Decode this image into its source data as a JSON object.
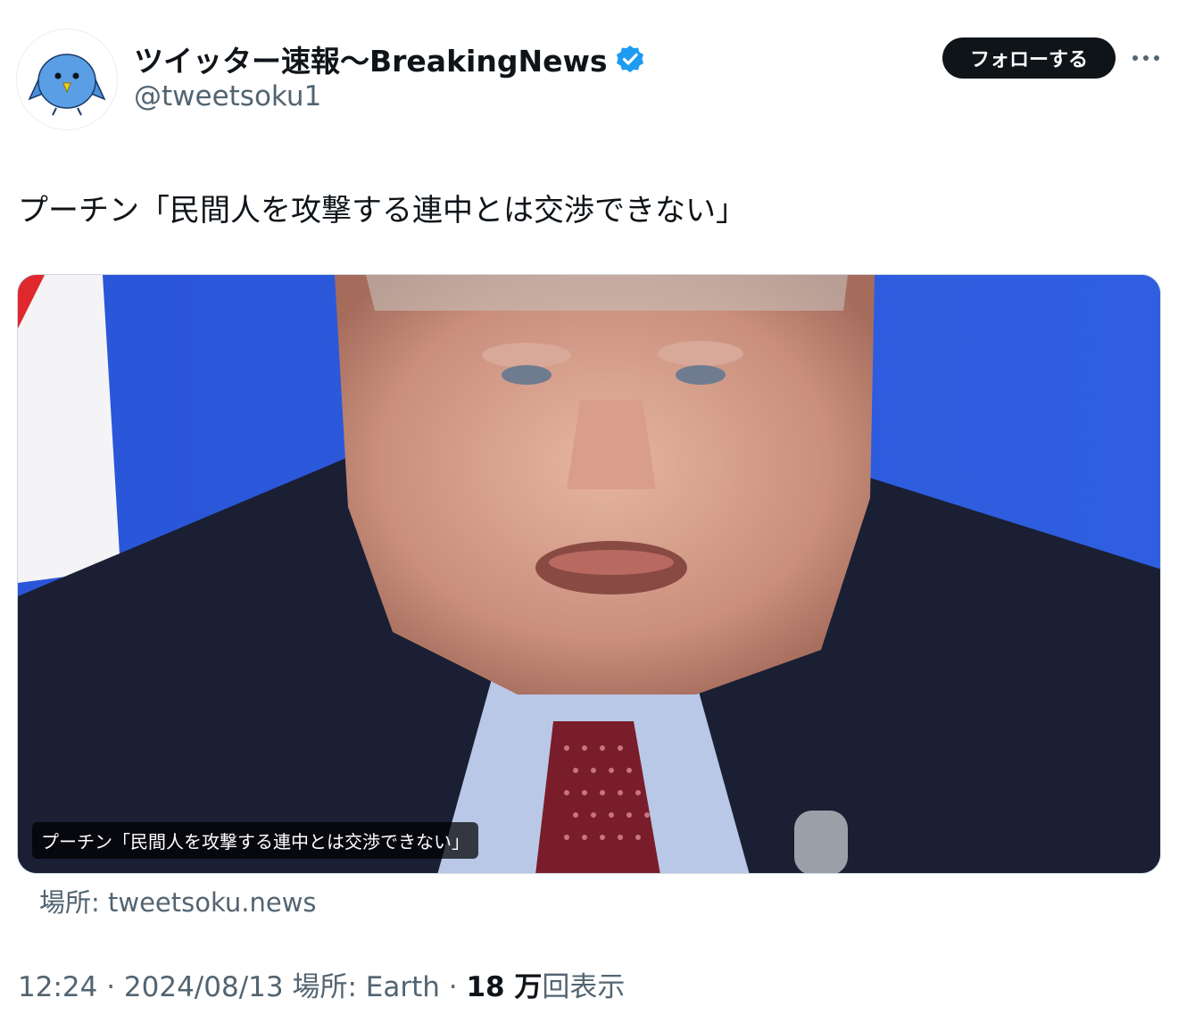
{
  "account": {
    "display_name": "ツイッター速報〜BreakingNews",
    "handle": "@tweetsoku1",
    "avatar_icon": "blue-bird-avatar",
    "verified_icon": "verified-badge-icon",
    "verified_color": "#1d9bf0"
  },
  "actions": {
    "follow_label": "フォローする",
    "more_icon": "more-options-icon"
  },
  "tweet": {
    "text": "プーチン「民間人を攻撃する連中とは交渉できない」"
  },
  "card": {
    "caption": "プーチン「民間人を攻撃する連中とは交渉できない」",
    "source": "場所: tweetsoku.news"
  },
  "meta": {
    "time": "12:24",
    "separator1": " · ",
    "date": "2024/08/13",
    "location": " 場所: Earth",
    "separator2": " · ",
    "views_count": "18 万",
    "views_label": "回表示"
  }
}
